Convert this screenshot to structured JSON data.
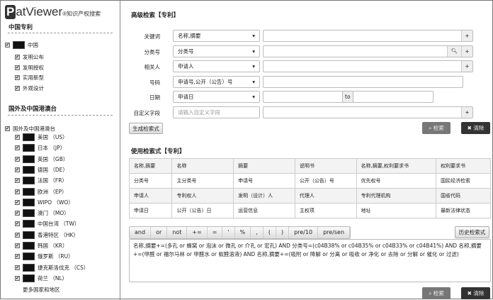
{
  "logo": {
    "p": "P",
    "text": "atViewer",
    "tag": "知识产权搜索"
  },
  "left": {
    "cn_title": "中国专利",
    "cn_root": "中国",
    "cn_items": [
      "发明公布",
      "发明授权",
      "实用新型",
      "外观设计"
    ],
    "intl_title": "国外及中国港澳台",
    "intl_root": "国外及中国港澳台",
    "countries": [
      "美国 （US）",
      "日本 （JP）",
      "英国 （GB）",
      "德国 （DE）",
      "法国 （FR）",
      "欧洲 （EP）",
      "WIPO （WO）",
      "澳门 （MO）",
      "中国台湾 （TW）",
      "香港特区 （HK）",
      "韩国 （KR）",
      "俄罗斯 （RU）",
      "捷克斯洛伐克 （CS）",
      "荷兰 （NL）"
    ],
    "more": "更多国家和地区"
  },
  "adv": {
    "title": "高级检索【专利】",
    "rows": [
      {
        "label": "关键词",
        "select": "名称,摘要"
      },
      {
        "label": "分类号",
        "select": "分类号"
      },
      {
        "label": "相关人",
        "select": "申请人"
      },
      {
        "label": "号码",
        "select": "申请号,公开（公告）号"
      },
      {
        "label": "日期",
        "select": "申请日"
      },
      {
        "label": "自定义字段",
        "placeholder": "请输入自定义字段"
      }
    ],
    "to": "to",
    "plus": "+",
    "gen": "生成检索式",
    "search": "检索",
    "clear": "清除"
  },
  "expr": {
    "title": "使用检索式【专利】",
    "table": [
      [
        "名称,摘要",
        "名称",
        "摘要",
        "说明书",
        "名称,摘要,权利要求书",
        "权利要求书"
      ],
      [
        "分类号",
        "主分类号",
        "申请号",
        "公开（公告）号",
        "优先权号",
        "国民经济检索"
      ],
      [
        "申请人",
        "专利权人",
        "发明（设计）人",
        "代理人",
        "专利代理机构",
        "国省代码"
      ],
      [
        "申请日",
        "公开（公告）日",
        "运营信息",
        "主权项",
        "地址",
        "最新法律状态"
      ]
    ],
    "ops": [
      "and",
      "or",
      "not",
      "+=",
      "=",
      "'",
      "%",
      ",",
      "(",
      ")",
      "pre/10",
      "pre/sen"
    ],
    "history": "历史检索式",
    "query": "名称,摘要+=(多孔 or  蜂窝 or 泡沫 or 微孔 or 介孔 or 宏孔) AND 分类号=(c04B38% or c04B35% or c04B33% or c04B41%) AND 名称,摘要+=(甲醛 or 福尔马林 or 甲醛水 or 蚁醛溶液) AND 名称,摘要+=(吸附 or 降解 or 分离 or 吸收 or 净化 or 去除 or 分解 or 催化 or 过滤)",
    "search": "检索",
    "clear": "清除"
  }
}
